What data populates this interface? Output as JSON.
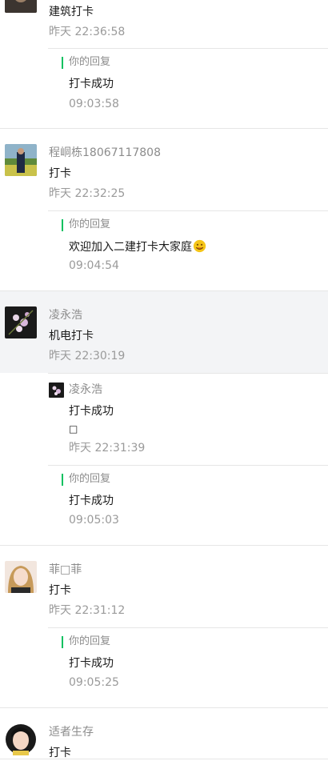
{
  "messages": [
    {
      "text": "建筑打卡",
      "time": "昨天 22:36:58",
      "reply": {
        "label": "你的回复",
        "text": "打卡成功",
        "time": "09:03:58"
      }
    },
    {
      "name": "程峒栋18067117808",
      "text": "打卡",
      "time": "昨天 22:32:25",
      "reply": {
        "label": "你的回复",
        "text": "欢迎加入二建打卡大家庭",
        "time": "09:04:54"
      }
    },
    {
      "name": "凌永浩",
      "text": "机电打卡",
      "time": "昨天 22:30:19",
      "followup": {
        "name": "凌永浩",
        "text": "打卡成功",
        "glyph": "□",
        "time": "昨天 22:31:39"
      },
      "reply": {
        "label": "你的回复",
        "text": "打卡成功",
        "time": "09:05:03"
      }
    },
    {
      "name": "菲□菲",
      "text": "打卡",
      "time": "昨天 22:31:12",
      "reply": {
        "label": "你的回复",
        "text": "打卡成功",
        "time": "09:05:25"
      }
    },
    {
      "name": "适者生存",
      "text": "打卡"
    }
  ]
}
